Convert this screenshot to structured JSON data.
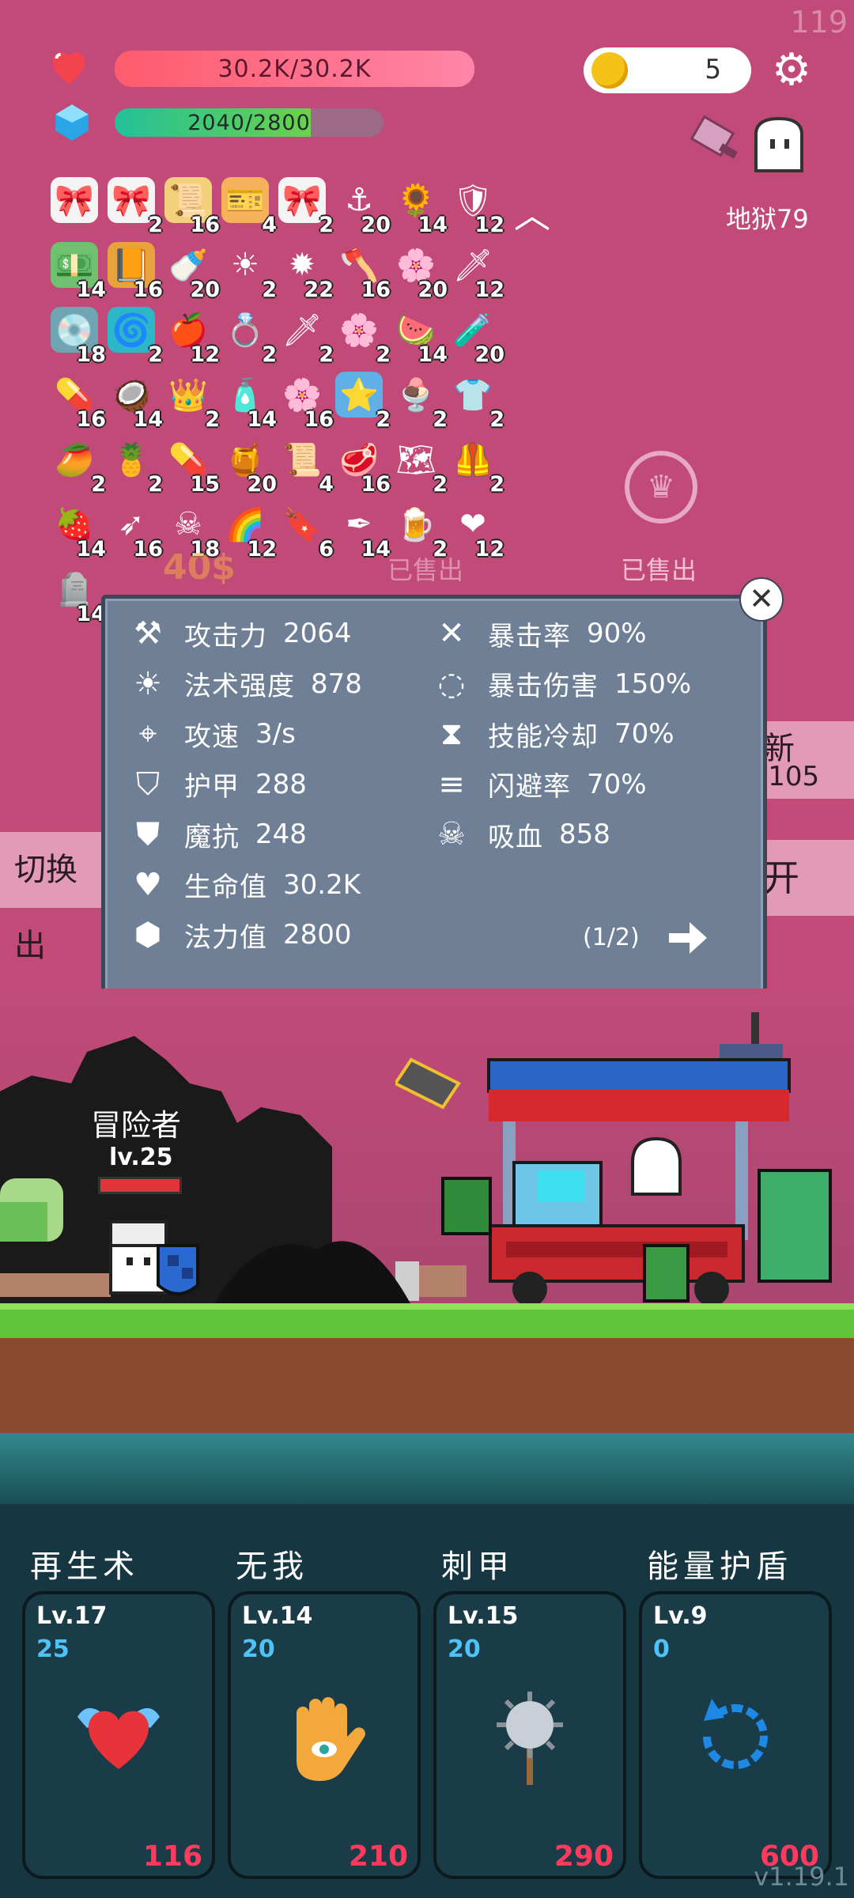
{
  "hud": {
    "hp_text": "30.2K/30.2K",
    "mp_text": "2040/2800",
    "mp_fraction": 0.729,
    "coins": "5",
    "fps": "119",
    "stage": "地狱79"
  },
  "inventory": [
    {
      "icon": "gift-card-icon",
      "count": "",
      "color": "#f4f4f4"
    },
    {
      "icon": "gift-card-icon",
      "count": "2",
      "color": "#f4f4f4"
    },
    {
      "icon": "scroll-icon",
      "count": "16",
      "color": "#f3d07a"
    },
    {
      "icon": "ticket-icon",
      "count": "4",
      "color": "#f6b25a"
    },
    {
      "icon": "gift-card-icon",
      "count": "2",
      "color": "#f4f4f4"
    },
    {
      "icon": "hook-icon",
      "count": "20",
      "color": "transparent"
    },
    {
      "icon": "sunflower-icon",
      "count": "14",
      "color": "transparent"
    },
    {
      "icon": "shield-round-icon",
      "count": "12",
      "color": "transparent"
    },
    {
      "icon": "cash-icon",
      "count": "14",
      "color": "#6fc06f"
    },
    {
      "icon": "book-icon",
      "count": "16",
      "color": "#e7a23c"
    },
    {
      "icon": "milk-bottle-icon",
      "count": "20",
      "color": "transparent"
    },
    {
      "icon": "sun-icon",
      "count": "2",
      "color": "transparent"
    },
    {
      "icon": "spike-ball-icon",
      "count": "22",
      "color": "transparent"
    },
    {
      "icon": "axe-icon",
      "count": "16",
      "color": "transparent"
    },
    {
      "icon": "flower-icon",
      "count": "20",
      "color": "transparent"
    },
    {
      "icon": "sword-icon",
      "count": "12",
      "color": "transparent"
    },
    {
      "icon": "disc-icon",
      "count": "18",
      "color": "#6fa5b2"
    },
    {
      "icon": "spiral-icon",
      "count": "2",
      "color": "#2bb7c6"
    },
    {
      "icon": "apple-icon",
      "count": "12",
      "color": "transparent"
    },
    {
      "icon": "ring-icon",
      "count": "2",
      "color": "transparent"
    },
    {
      "icon": "sword-icon",
      "count": "2",
      "color": "transparent"
    },
    {
      "icon": "flower-icon",
      "count": "2",
      "color": "transparent"
    },
    {
      "icon": "watermelon-icon",
      "count": "14",
      "color": "transparent"
    },
    {
      "icon": "potion-icon",
      "count": "20",
      "color": "transparent"
    },
    {
      "icon": "pill-icon",
      "count": "16",
      "color": "transparent"
    },
    {
      "icon": "coconut-icon",
      "count": "14",
      "color": "transparent"
    },
    {
      "icon": "crown-icon",
      "count": "2",
      "color": "transparent"
    },
    {
      "icon": "spray-icon",
      "count": "14",
      "color": "transparent"
    },
    {
      "icon": "flower-icon",
      "count": "16",
      "color": "transparent"
    },
    {
      "icon": "star-card-icon",
      "count": "2",
      "color": "#5fb0e6"
    },
    {
      "icon": "ice-cream-icon",
      "count": "2",
      "color": "transparent"
    },
    {
      "icon": "shirt-icon",
      "count": "2",
      "color": "transparent"
    },
    {
      "icon": "mango-icon",
      "count": "2",
      "color": "transparent"
    },
    {
      "icon": "pineapple-icon",
      "count": "2",
      "color": "transparent"
    },
    {
      "icon": "capsule-icon",
      "count": "15",
      "color": "transparent"
    },
    {
      "icon": "jar-icon",
      "count": "20",
      "color": "transparent"
    },
    {
      "icon": "scroll-icon",
      "count": "4",
      "color": "transparent"
    },
    {
      "icon": "meat-icon",
      "count": "16",
      "color": "transparent"
    },
    {
      "icon": "map-icon",
      "count": "2",
      "color": "transparent"
    },
    {
      "icon": "armor-icon",
      "count": "2",
      "color": "transparent"
    },
    {
      "icon": "strawberry-icon",
      "count": "14",
      "color": "transparent"
    },
    {
      "icon": "arrows-icon",
      "count": "16",
      "color": "transparent"
    },
    {
      "icon": "pirate-ship-icon",
      "count": "18",
      "color": "transparent"
    },
    {
      "icon": "rainbow-icon",
      "count": "12",
      "color": "transparent"
    },
    {
      "icon": "bookmark-icon",
      "count": "6",
      "color": "transparent"
    },
    {
      "icon": "pen-icon",
      "count": "14",
      "color": "transparent"
    },
    {
      "icon": "beer-icon",
      "count": "2",
      "color": "transparent"
    },
    {
      "icon": "heart-icon",
      "count": "12",
      "color": "transparent"
    },
    {
      "icon": "tombstone-icon",
      "count": "14",
      "color": "transparent"
    }
  ],
  "shop": {
    "sold_label": "已售出",
    "price_fragment": "40$",
    "refresh_label": "新",
    "refresh_cost": "-105",
    "switch_label": "切换出",
    "open_label": "开"
  },
  "stats": {
    "left": [
      {
        "icon": "axe-icon",
        "label": "攻击力",
        "value": "2064"
      },
      {
        "icon": "sun-icon",
        "label": "法术强度",
        "value": "878"
      },
      {
        "icon": "crosshair-icon",
        "label": "攻速",
        "value": "3/s"
      },
      {
        "icon": "shield-icon",
        "label": "护甲",
        "value": "288"
      },
      {
        "icon": "magic-shield-icon",
        "label": "魔抗",
        "value": "248"
      },
      {
        "icon": "heart-icon",
        "label": "生命值",
        "value": "30.2K"
      },
      {
        "icon": "crystal-icon",
        "label": "法力值",
        "value": "2800"
      }
    ],
    "right": [
      {
        "icon": "crit-icon",
        "label": "暴击率",
        "value": "90%"
      },
      {
        "icon": "crit-damage-icon",
        "label": "暴击伤害",
        "value": "150%"
      },
      {
        "icon": "hourglass-icon",
        "label": "技能冷却",
        "value": "70%"
      },
      {
        "icon": "dodge-icon",
        "label": "闪避率",
        "value": "70%"
      },
      {
        "icon": "skull-icon",
        "label": "吸血",
        "value": "858"
      }
    ],
    "page": "(1/2)"
  },
  "player": {
    "name": "冒险者",
    "level": "lv.25",
    "hp_fraction": 1.0
  },
  "skills": [
    {
      "name": "再生术",
      "level": "Lv.17",
      "value": "25",
      "cost": "116",
      "icon": "winged-heart-icon"
    },
    {
      "name": "无我",
      "level": "Lv.14",
      "value": "20",
      "cost": "210",
      "icon": "hamsa-hand-icon"
    },
    {
      "name": "刺甲",
      "level": "Lv.15",
      "value": "20",
      "cost": "290",
      "icon": "spiked-mace-icon"
    },
    {
      "name": "能量护盾",
      "level": "Lv.9",
      "value": "0",
      "cost": "600",
      "icon": "refresh-icon"
    }
  ],
  "version": "v1.19.1",
  "colors": {
    "background": "#c14a78",
    "hp": "#ff6b84",
    "mp": "#2fc29a",
    "panel": "#6f7f96",
    "skill_cost": "#ff3a5c",
    "skill_value": "#4fc3f7"
  }
}
